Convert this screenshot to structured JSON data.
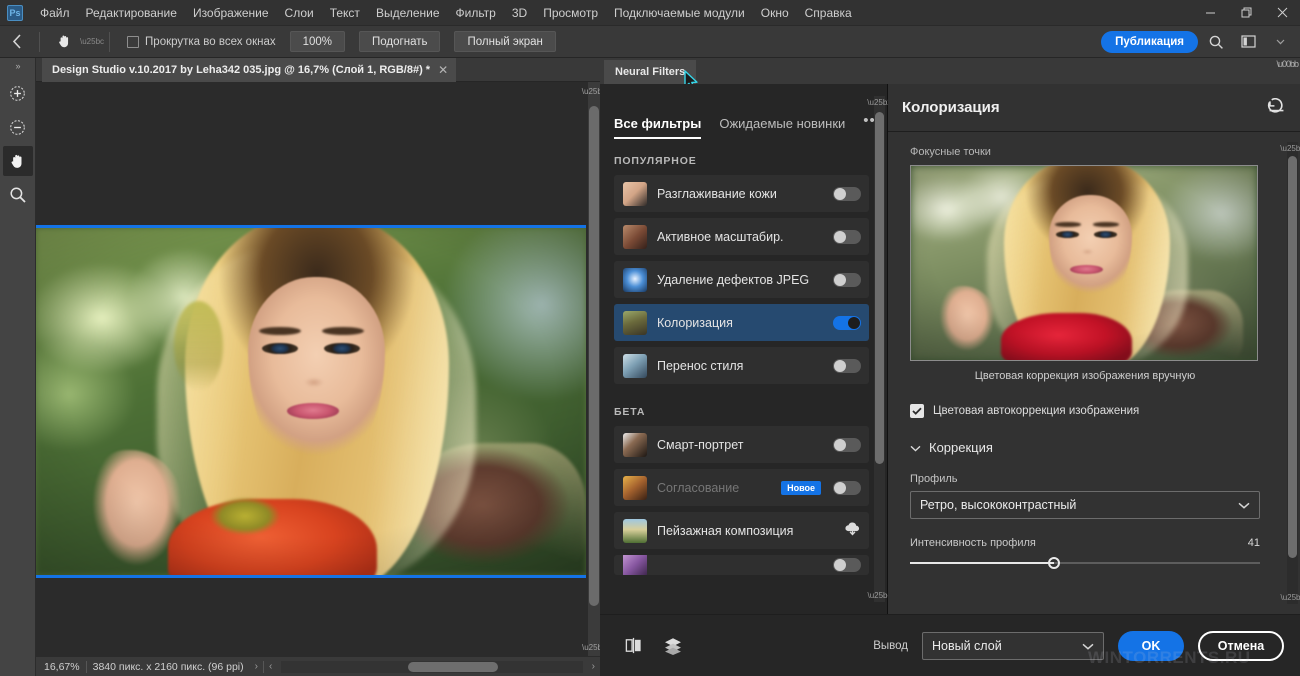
{
  "app": {
    "logo": "Ps",
    "menus": [
      "Файл",
      "Редактирование",
      "Изображение",
      "Слои",
      "Текст",
      "Выделение",
      "Фильтр",
      "3D",
      "Просмотр",
      "Подключаемые модули",
      "Окно",
      "Справка"
    ],
    "window_controls": {
      "minimize": "—",
      "restore": "❐",
      "close": "✕"
    }
  },
  "options_bar": {
    "back_label": "‹",
    "tool_icon": "hand-icon",
    "scroll_all_windows": "Прокрутка во всех окнах",
    "scroll_all_windows_checked": false,
    "zoom_100": "100%",
    "fit_screen": "Подогнать",
    "full_screen": "Полный экран",
    "publish": "Публикация",
    "search_icon": "search-icon",
    "workspace_icon": "workspace-icon",
    "caret": "⌄"
  },
  "toolbar": {
    "expand": "»",
    "tools": [
      {
        "name": "zoom-in-tool",
        "glyph": "+",
        "active": false
      },
      {
        "name": "zoom-out-tool",
        "glyph": "−",
        "active": false
      },
      {
        "name": "hand-tool",
        "glyph": "hand",
        "active": true
      },
      {
        "name": "magnifier-tool",
        "glyph": "magnifier",
        "active": false
      }
    ]
  },
  "document": {
    "tab_title": "Design Studio v.10.2017 by Leha342 035.jpg @ 16,7% (Слой 1, RGB/8#) *",
    "close_glyph": "✕"
  },
  "status_bar": {
    "zoom": "16,67%",
    "dimensions": "3840 пикс. x 2160 пикс. (96 ppi)",
    "expand_right": "›",
    "nav_left": "‹",
    "nav_right": "›"
  },
  "neural_filters": {
    "panel_tab": "Neural Filters",
    "tabs": [
      {
        "label": "Все фильтры",
        "active": true
      },
      {
        "label": "Ожидаемые новинки",
        "active": false
      }
    ],
    "overflow_menu": "•••",
    "sections": [
      {
        "title": "ПОПУЛЯРНОЕ",
        "filters": [
          {
            "label": "Разглаживание кожи",
            "enabled": false,
            "selected": false,
            "disabled": false,
            "badge": null,
            "download": false,
            "thumb": "thumb-skin"
          },
          {
            "label": "Активное масштабир.",
            "enabled": false,
            "selected": false,
            "disabled": false,
            "badge": null,
            "download": false,
            "thumb": "thumb-upscale"
          },
          {
            "label": "Удаление дефектов JPEG",
            "enabled": false,
            "selected": false,
            "disabled": false,
            "badge": null,
            "download": false,
            "thumb": "thumb-jpeg"
          },
          {
            "label": "Колоризация",
            "enabled": true,
            "selected": true,
            "disabled": false,
            "badge": null,
            "download": false,
            "thumb": "thumb-colorize"
          },
          {
            "label": "Перенос стиля",
            "enabled": false,
            "selected": false,
            "disabled": false,
            "badge": null,
            "download": false,
            "thumb": "thumb-style"
          }
        ]
      },
      {
        "title": "БЕТА",
        "filters": [
          {
            "label": "Смарт-портрет",
            "enabled": false,
            "selected": false,
            "disabled": false,
            "badge": null,
            "download": false,
            "thumb": "thumb-portrait"
          },
          {
            "label": "Согласование",
            "enabled": false,
            "selected": false,
            "disabled": true,
            "badge": "Новое",
            "download": false,
            "thumb": "thumb-harmony"
          },
          {
            "label": "Пейзажная композиция",
            "enabled": false,
            "selected": false,
            "disabled": false,
            "badge": null,
            "download": true,
            "thumb": "thumb-landscape"
          }
        ]
      }
    ],
    "properties": {
      "title": "Колоризация",
      "reset_icon": "reset-icon",
      "focus_points_label": "Фокусные точки",
      "preview_caption": "Цветовая коррекция изображения вручную",
      "auto_color_label": "Цветовая автокоррекция изображения",
      "auto_color_checked": true,
      "correction_section": "Коррекция",
      "correction_expanded": true,
      "profile_label": "Профиль",
      "profile_value": "Ретро, высококонтрастный",
      "intensity_label": "Интенсивность профиля",
      "intensity_value": "41",
      "intensity_percent": 41
    },
    "footer": {
      "compare_icon": "before-after-icon",
      "layers_icon": "layers-icon",
      "output_label": "Вывод",
      "output_value": "Новый слой",
      "ok": "OK",
      "cancel": "Отмена"
    }
  },
  "watermark": "WINTORRENTS.RU",
  "colors": {
    "accent": "#1473e6",
    "selection": "#264a70",
    "window_bg": "#323232",
    "panel_bg": "#262626",
    "canvas_bg": "#2b2b2b"
  }
}
